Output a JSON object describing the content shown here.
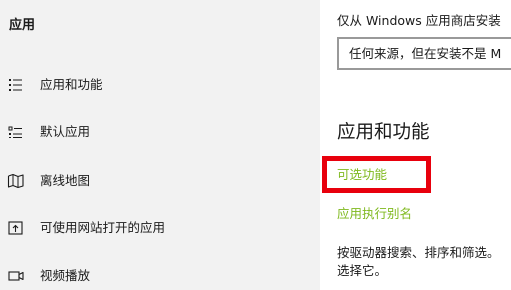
{
  "sidebar": {
    "title": "应用",
    "items": [
      {
        "label": "应用和功能",
        "icon": "list-icon"
      },
      {
        "label": "默认应用",
        "icon": "default-apps-icon"
      },
      {
        "label": "离线地图",
        "icon": "map-icon"
      },
      {
        "label": "可使用网站打开的应用",
        "icon": "open-website-icon"
      },
      {
        "label": "视频播放",
        "icon": "video-icon"
      }
    ]
  },
  "main": {
    "install_source_label": "仅从 Windows 应用商店安装",
    "install_source_value": "任何来源，但在安装不是 M",
    "section_heading": "应用和功能",
    "optional_features_link": "可选功能",
    "app_alias_link": "应用执行别名",
    "description_line1": "按驱动器搜索、排序和筛选。",
    "description_line2": "选择它。"
  },
  "colors": {
    "link": "#7fb91e",
    "highlight": "#e8000d",
    "sidebar_bg": "#f2f2f2"
  }
}
